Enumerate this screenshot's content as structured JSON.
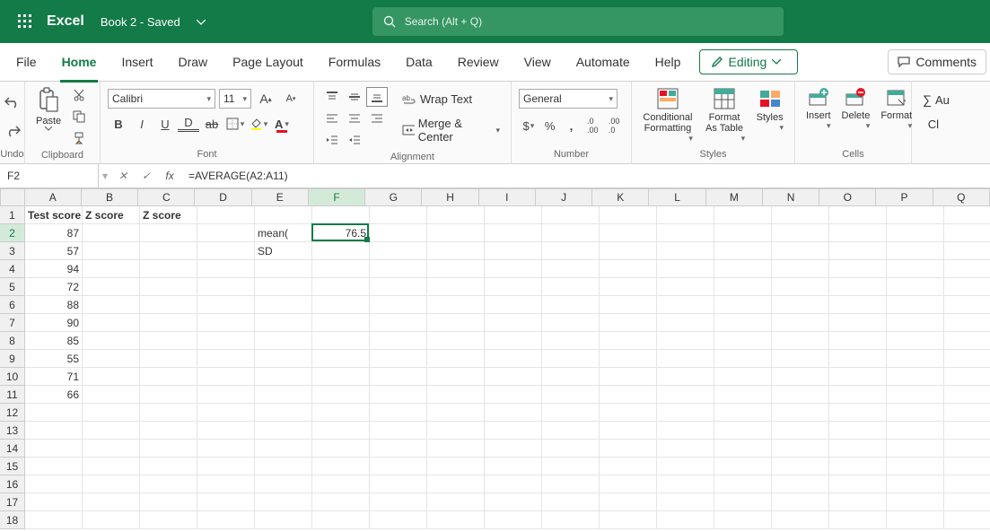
{
  "titlebar": {
    "app_name": "Excel",
    "doc_title": "Book 2  -  Saved"
  },
  "search": {
    "placeholder": "Search (Alt + Q)"
  },
  "menu": {
    "items": [
      "File",
      "Home",
      "Insert",
      "Draw",
      "Page Layout",
      "Formulas",
      "Data",
      "Review",
      "View",
      "Automate",
      "Help"
    ],
    "active": "Home",
    "editing_label": "Editing",
    "comments_label": "Comments"
  },
  "ribbon": {
    "undo_label": "Undo",
    "clipboard": {
      "paste_label": "Paste",
      "group_label": "Clipboard"
    },
    "font": {
      "name": "Calibri",
      "size": "11",
      "group_label": "Font"
    },
    "alignment": {
      "wrap_label": "Wrap Text",
      "merge_label": "Merge & Center",
      "group_label": "Alignment"
    },
    "number": {
      "format": "General",
      "group_label": "Number"
    },
    "styles": {
      "cond_label": "Conditional Formatting",
      "table_label": "Format As Table",
      "styles_label": "Styles",
      "group_label": "Styles"
    },
    "cells": {
      "insert_label": "Insert",
      "delete_label": "Delete",
      "format_label": "Format",
      "group_label": "Cells"
    },
    "editing_extra": {
      "autosum_label": "Au",
      "clear_label": "Cl"
    }
  },
  "formula_bar": {
    "cell_ref": "F2",
    "fx_label": "fx",
    "formula": "=AVERAGE(A2:A11)"
  },
  "chart_data": {
    "type": "table",
    "columns": [
      "",
      "A",
      "B",
      "C",
      "D",
      "E",
      "F",
      "G",
      "H",
      "I",
      "J",
      "K",
      "L",
      "M",
      "N",
      "O",
      "P",
      "Q"
    ],
    "active_column_index": 6,
    "rows": [
      1,
      2,
      3,
      4,
      5,
      6,
      7,
      8,
      9,
      10,
      11,
      12,
      13,
      14,
      15,
      16,
      17,
      18
    ],
    "active_row_index": 2,
    "selection": "F2",
    "cells": {
      "A1": {
        "v": "Test score",
        "type": "text",
        "bold": true
      },
      "B1": {
        "v": "Z score",
        "type": "text",
        "bold": true
      },
      "C1": {
        "v": "Z score",
        "type": "text",
        "bold": true
      },
      "A2": {
        "v": "87",
        "type": "num"
      },
      "A3": {
        "v": "57",
        "type": "num"
      },
      "A4": {
        "v": "94",
        "type": "num"
      },
      "A5": {
        "v": "72",
        "type": "num"
      },
      "A6": {
        "v": "88",
        "type": "num"
      },
      "A7": {
        "v": "90",
        "type": "num"
      },
      "A8": {
        "v": "85",
        "type": "num"
      },
      "A9": {
        "v": "55",
        "type": "num"
      },
      "A10": {
        "v": "71",
        "type": "num"
      },
      "A11": {
        "v": "66",
        "type": "num"
      },
      "E2": {
        "v": "mean(",
        "type": "text"
      },
      "E3": {
        "v": "SD",
        "type": "text"
      },
      "F2": {
        "v": "76.5",
        "type": "num"
      }
    }
  }
}
